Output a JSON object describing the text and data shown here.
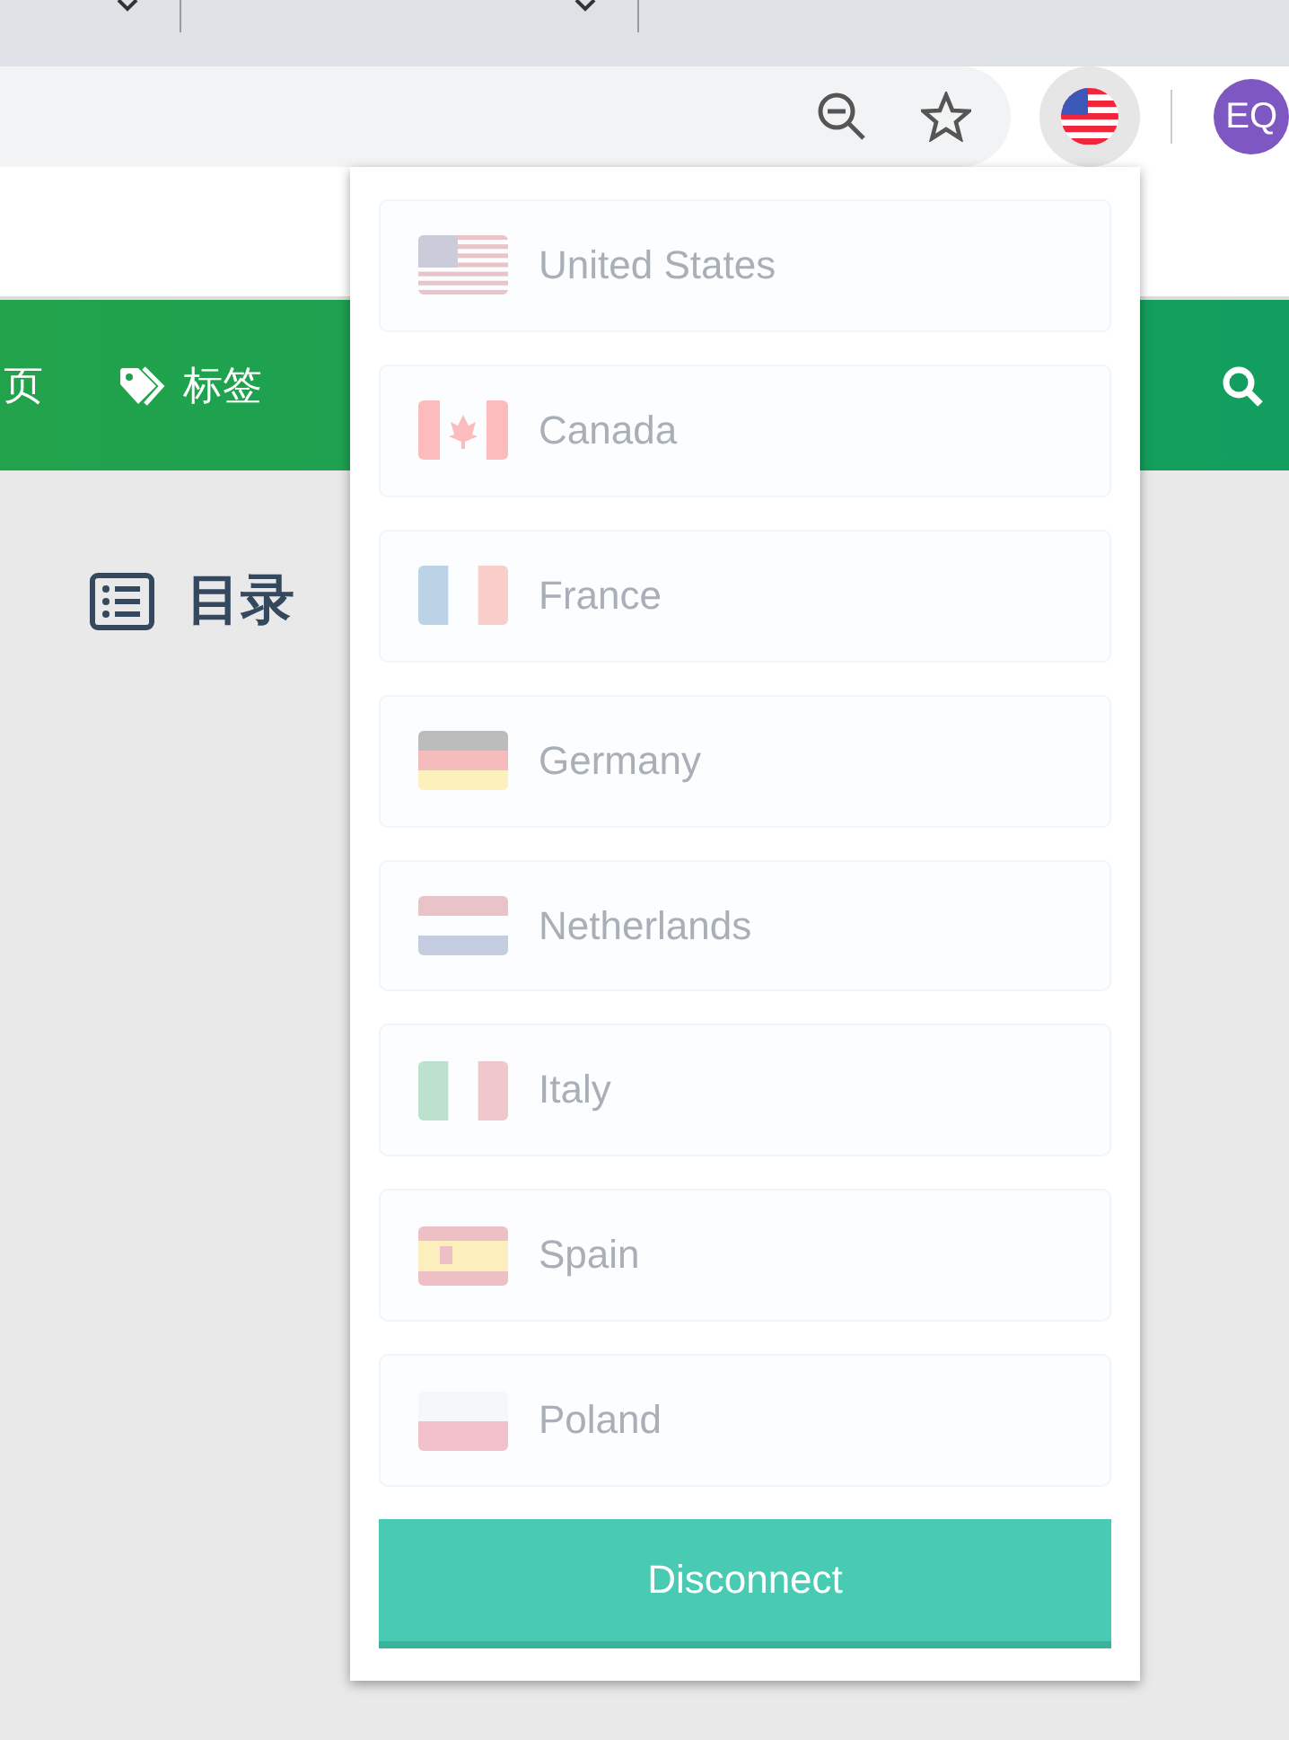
{
  "toolbar": {
    "avatar": "EQ"
  },
  "nav": {
    "items": [
      {
        "label": "页"
      },
      {
        "label": "标签"
      }
    ]
  },
  "sidebar": {
    "title": "目录"
  },
  "popup": {
    "countries": [
      {
        "name": "United States",
        "disabled": true,
        "kind": "us"
      },
      {
        "name": "Canada",
        "disabled": true,
        "kind": "canada"
      },
      {
        "name": "France",
        "disabled": true,
        "kind": "france"
      },
      {
        "name": "Germany",
        "disabled": true,
        "kind": "germany"
      },
      {
        "name": "Netherlands",
        "disabled": true,
        "kind": "netherlands"
      },
      {
        "name": "Italy",
        "disabled": true,
        "kind": "italy"
      },
      {
        "name": "Spain",
        "disabled": true,
        "kind": "spain"
      },
      {
        "name": "Poland",
        "disabled": true,
        "kind": "poland"
      }
    ],
    "button": "Disconnect"
  }
}
